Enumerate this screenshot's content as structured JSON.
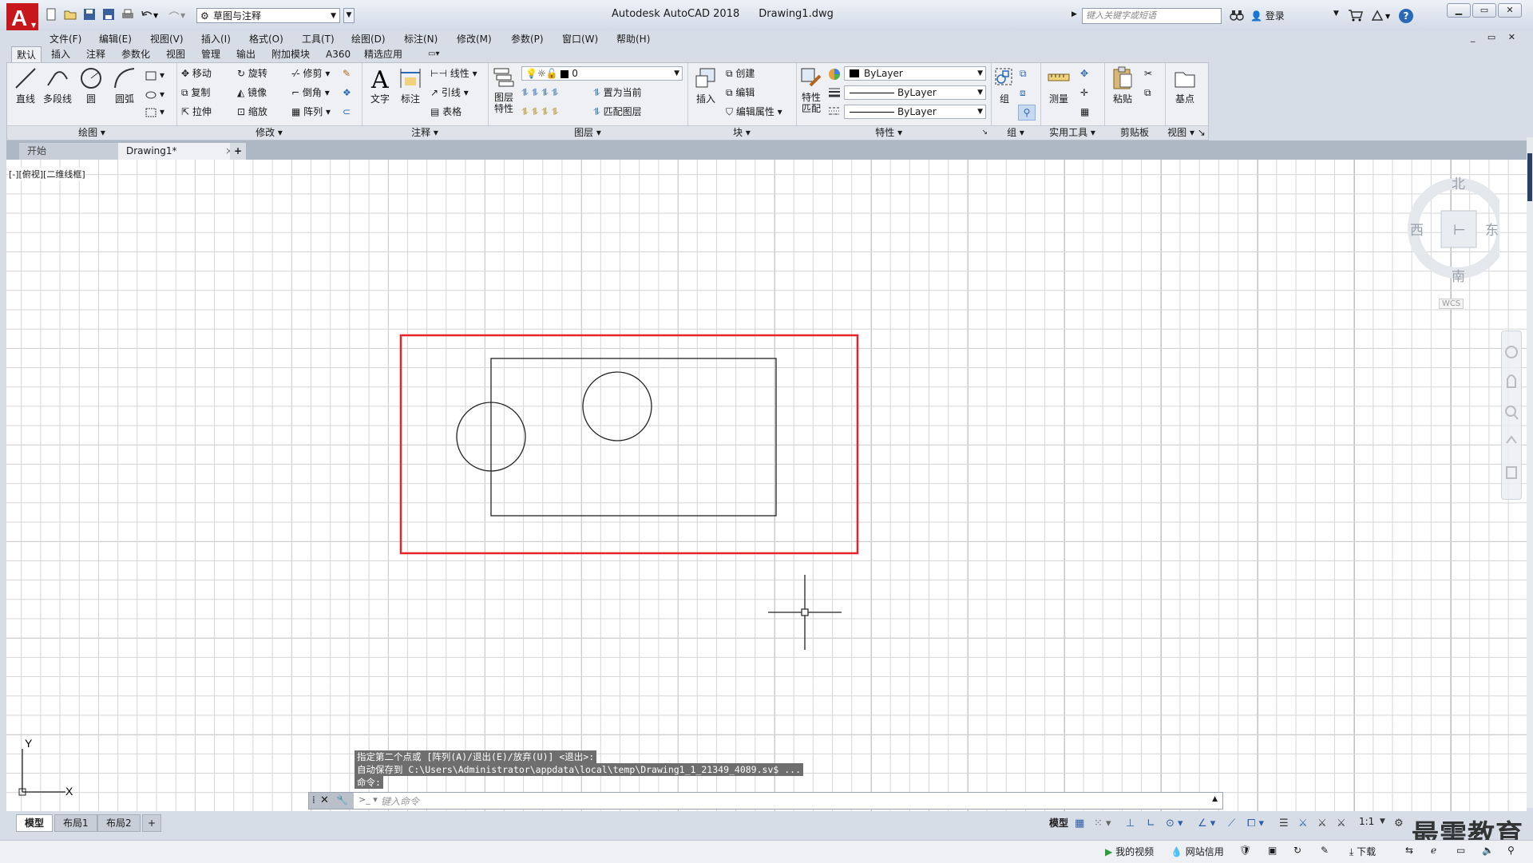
{
  "window": {
    "app_name": "Autodesk AutoCAD 2018",
    "file_name": "Drawing1.dwg",
    "search_placeholder": "键入关键字或短语",
    "login_label": "登录",
    "workspace": "草图与注释"
  },
  "menu": [
    "文件(F)",
    "编辑(E)",
    "视图(V)",
    "插入(I)",
    "格式(O)",
    "工具(T)",
    "绘图(D)",
    "标注(N)",
    "修改(M)",
    "参数(P)",
    "窗口(W)",
    "帮助(H)"
  ],
  "ribbon_tabs": [
    "默认",
    "插入",
    "注释",
    "参数化",
    "视图",
    "管理",
    "输出",
    "附加模块",
    "A360",
    "精选应用"
  ],
  "ribbon": {
    "draw": {
      "title": "绘图",
      "line": "直线",
      "polyline": "多段线",
      "circle": "圆",
      "arc": "圆弧"
    },
    "modify": {
      "title": "修改",
      "move": "移动",
      "rotate": "旋转",
      "trim": "修剪",
      "copy": "复制",
      "mirror": "镜像",
      "fillet": "倒角",
      "stretch": "拉伸",
      "scale": "缩放",
      "array": "阵列"
    },
    "annotation": {
      "title": "注释",
      "text": "文字",
      "dimension": "标注",
      "linear": "线性",
      "leader": "引线",
      "table": "表格"
    },
    "layers": {
      "title": "图层",
      "layer_props": "图层\n特性",
      "current_layer": "0",
      "set_current": "置为当前",
      "match_layer": "匹配图层"
    },
    "block": {
      "title": "块",
      "insert": "插入",
      "create": "创建",
      "edit": "编辑",
      "edit_attr": "编辑属性"
    },
    "properties": {
      "title": "特性",
      "match": "特性\n匹配",
      "color": "ByLayer",
      "linetype": "ByLayer",
      "lineweight": "ByLayer"
    },
    "groups": {
      "title": "组",
      "group": "组"
    },
    "utilities": {
      "title": "实用工具",
      "measure": "测量"
    },
    "clipboard": {
      "title": "剪贴板",
      "paste": "粘贴"
    },
    "view": {
      "title": "视图",
      "base": "基点"
    }
  },
  "doc_tabs": {
    "start": "开始",
    "drawing": "Drawing1*"
  },
  "viewport_label": "[-][俯视][二维线框]",
  "viewcube": {
    "north": "北",
    "south": "南",
    "east": "东",
    "west": "西",
    "wcs": "WCS"
  },
  "command": {
    "history": [
      "指定第二个点或 [阵列(A)/退出(E)/放弃(U)] <退出>:",
      "自动保存到 C:\\Users\\Administrator\\appdata\\local\\temp\\Drawing1_1_21349_4089.sv$ ...",
      "命令:"
    ],
    "placeholder": "键入命令"
  },
  "layout_tabs": [
    "模型",
    "布局1",
    "布局2"
  ],
  "status": {
    "model": "模型",
    "scale": "1:1"
  },
  "taskstrip": {
    "my_video": "我的视频",
    "net_credit": "网站信用",
    "download": "下载"
  },
  "watermark": "最需教育",
  "colors": {
    "highlight_rect": "#e8242a",
    "accent": "#2a68b8",
    "geometry": "#222222"
  }
}
